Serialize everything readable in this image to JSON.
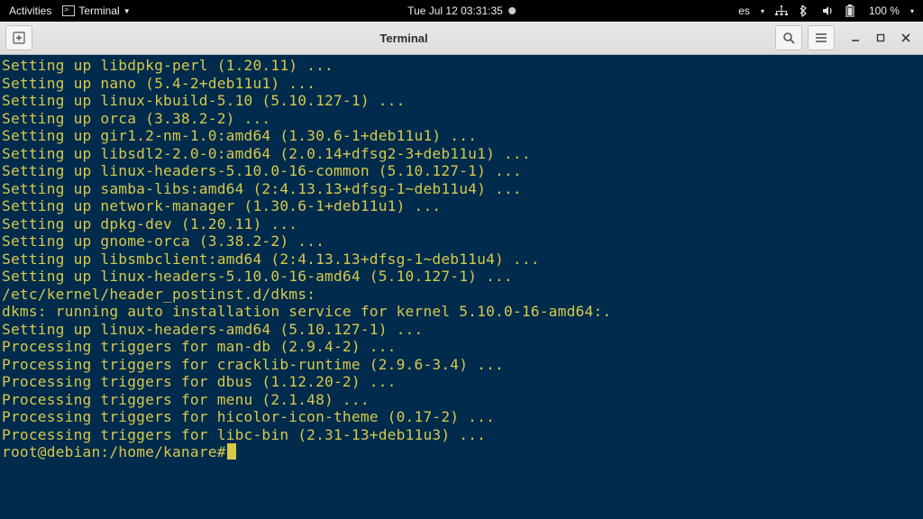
{
  "panel": {
    "activities": "Activities",
    "app_name": "Terminal",
    "datetime": "Tue Jul 12  03:31:35",
    "input_lang": "es",
    "battery": "100 %"
  },
  "window": {
    "title": "Terminal"
  },
  "terminal": {
    "lines": [
      "Setting up libdpkg-perl (1.20.11) ...",
      "Setting up nano (5.4-2+deb11u1) ...",
      "Setting up linux-kbuild-5.10 (5.10.127-1) ...",
      "Setting up orca (3.38.2-2) ...",
      "Setting up gir1.2-nm-1.0:amd64 (1.30.6-1+deb11u1) ...",
      "Setting up libsdl2-2.0-0:amd64 (2.0.14+dfsg2-3+deb11u1) ...",
      "Setting up linux-headers-5.10.0-16-common (5.10.127-1) ...",
      "Setting up samba-libs:amd64 (2:4.13.13+dfsg-1~deb11u4) ...",
      "Setting up network-manager (1.30.6-1+deb11u1) ...",
      "Setting up dpkg-dev (1.20.11) ...",
      "Setting up gnome-orca (3.38.2-2) ...",
      "Setting up libsmbclient:amd64 (2:4.13.13+dfsg-1~deb11u4) ...",
      "Setting up linux-headers-5.10.0-16-amd64 (5.10.127-1) ...",
      "/etc/kernel/header_postinst.d/dkms:",
      "dkms: running auto installation service for kernel 5.10.0-16-amd64:.",
      "Setting up linux-headers-amd64 (5.10.127-1) ...",
      "Processing triggers for man-db (2.9.4-2) ...",
      "Processing triggers for cracklib-runtime (2.9.6-3.4) ...",
      "Processing triggers for dbus (1.12.20-2) ...",
      "Processing triggers for menu (2.1.48) ...",
      "Processing triggers for hicolor-icon-theme (0.17-2) ...",
      "Processing triggers for libc-bin (2.31-13+deb11u3) ..."
    ],
    "prompt_user_host": "root@debian",
    "prompt_path": "/home/kanare",
    "prompt_symbol": "#"
  }
}
